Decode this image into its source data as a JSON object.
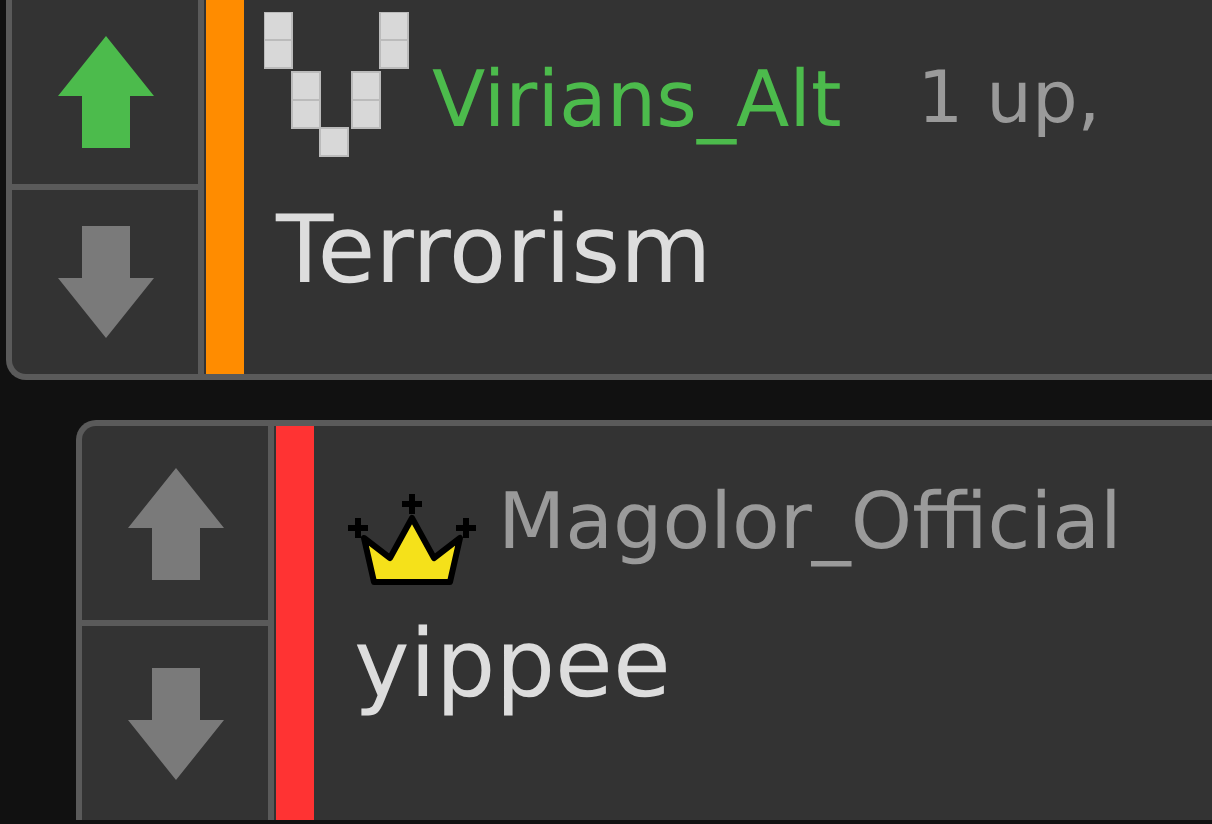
{
  "comments": [
    {
      "kind": "pixel-v",
      "author": "Virians_Alt",
      "author_highlighted": true,
      "meta": "1 up,",
      "body": "Terrorism",
      "color": "#ff8c00",
      "upvoted": true,
      "downvoted": false
    },
    {
      "kind": "crown",
      "author": "Magolor_Official",
      "author_highlighted": false,
      "body": "yippee",
      "color": "#ff3333",
      "upvoted": false,
      "downvoted": false
    }
  ]
}
